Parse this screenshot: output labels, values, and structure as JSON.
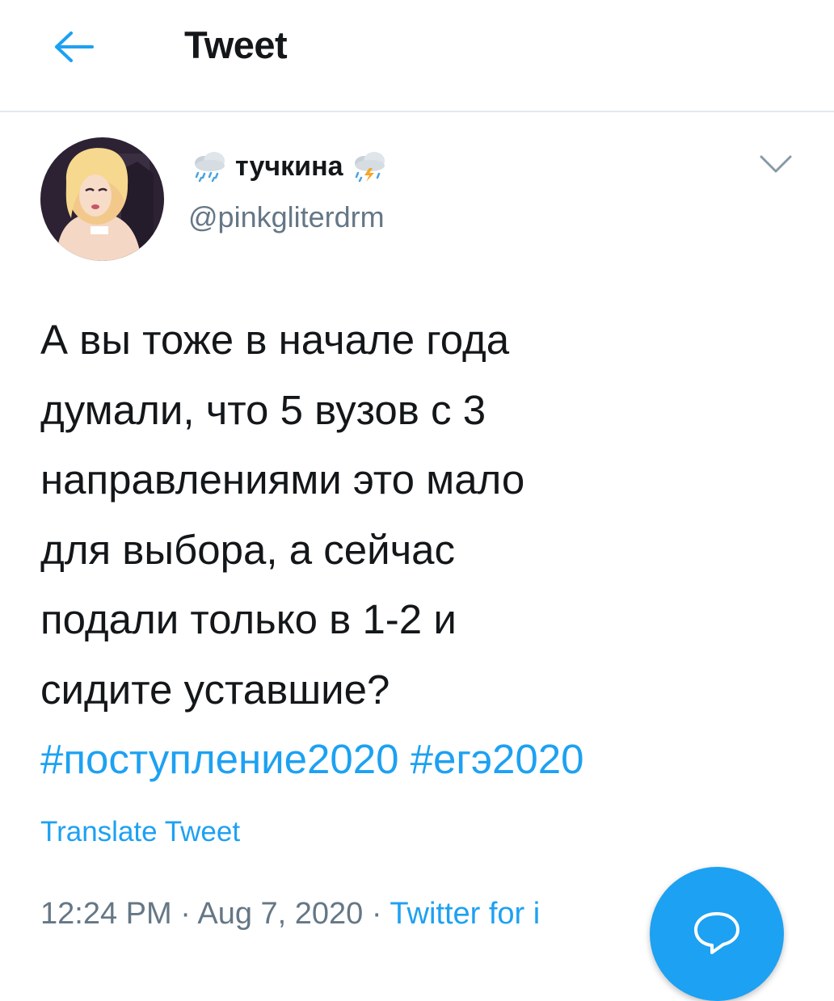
{
  "header": {
    "title": "Tweet",
    "back_icon": "arrow-left-icon"
  },
  "author": {
    "display_name": "тучкина",
    "leading_emoji": "rain-cloud-icon",
    "trailing_emoji": "storm-cloud-icon",
    "handle": "@pinkgliterdrm",
    "menu_icon": "chevron-down-icon"
  },
  "tweet": {
    "lines": [
      "А вы тоже в начале года",
      "думали, что 5 вузов с 3",
      "направлениями это мало",
      "для выбора, а сейчас",
      "подали только в 1-2 и",
      "сидите уставшие?"
    ],
    "hashtags": [
      "#поступление2020",
      "#егэ2020"
    ],
    "translate_label": "Translate Tweet",
    "time": "12:24 PM",
    "separator": "·",
    "date": "Aug 7, 2020",
    "source": "Twitter for i"
  },
  "fab": {
    "icon": "compose-reply-icon"
  },
  "colors": {
    "accent": "#1da1f2",
    "text": "#14171a",
    "muted": "#657786",
    "divider": "#e1e8ed"
  }
}
